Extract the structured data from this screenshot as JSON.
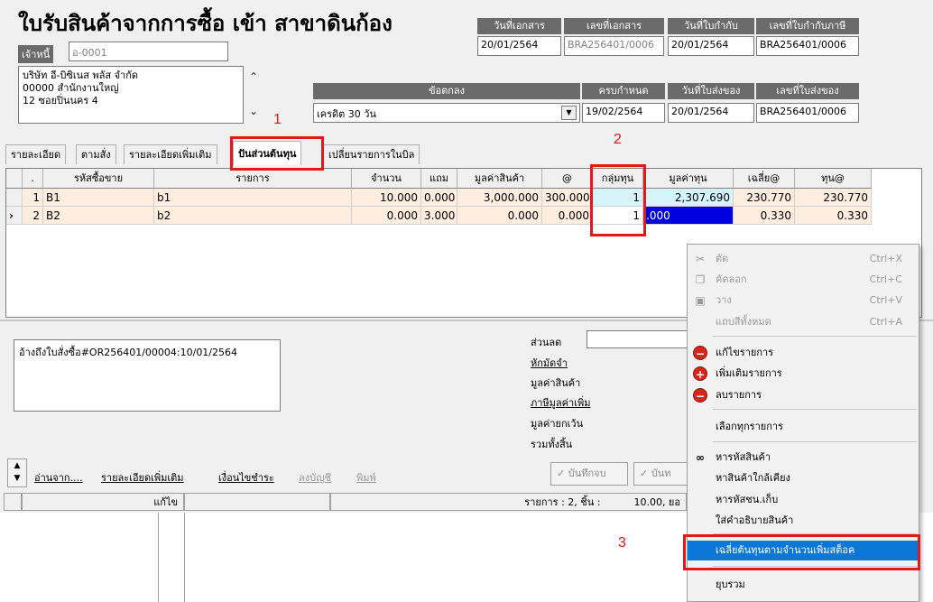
{
  "window": {
    "title": "ใบรับสินค้าจากการซื้อ เข้า สาขาดินก้อง"
  },
  "creditor": {
    "label": "เจ้าหนี้",
    "code": "อ-0001"
  },
  "supplier_address": [
    "บริษัท อี-บิซิเนส พลัส จำกัด",
    "00000 สำนักงานใหญ่",
    "12 ซอยปิ่นนคร 4"
  ],
  "doc_header": {
    "date_label": "วันที่เอกสาร",
    "date_value": "20/01/2564",
    "number_label": "เลขที่เอกสาร",
    "number_value": "BRA256401/0006",
    "tax_date_label": "วันที่ใบกำกับ",
    "tax_date_value": "20/01/2564",
    "tax_no_label": "เลขที่ใบกำกับภาษี",
    "tax_no_value": "BRA256401/0006"
  },
  "terms": {
    "terms_label": "ข้อตกลง",
    "terms_value": "เครดิต 30 วัน",
    "due_label": "ครบกำหนด",
    "due_value": "19/02/2564",
    "delivery_date_label": "วันที่ใบส่งของ",
    "delivery_date_value": "20/01/2564",
    "delivery_no_label": "เลขที่ใบส่งของ",
    "delivery_no_value": "BRA256401/0006"
  },
  "tabs": [
    {
      "label": "รายละเอียด"
    },
    {
      "label": "ตามสั่ง"
    },
    {
      "label": "รายละเอียดเพิ่มเติม"
    },
    {
      "label": "ปันส่วนต้นทุน",
      "active": true
    },
    {
      "label": "เปลี่ยนรายการในบิล"
    }
  ],
  "grid": {
    "columns": [
      ".",
      "รหัสซื้อขาย",
      "รายการ",
      "จำนวน",
      "แถม",
      "มูลค่าสินค้า",
      "@",
      "กลุ่มทุน",
      "มูลค่าทุน",
      "เฉลี่ย@",
      "ทุน@"
    ],
    "rows": [
      {
        "indicator": "",
        "no": "1",
        "code": "B1",
        "name": "b1",
        "qty": "10.000",
        "free": "0.000",
        "value": "3,000.000",
        "unit": "300.000",
        "group": "1",
        "cost_value": "2,307.690",
        "avg": "230.770",
        "cost": "230.770"
      },
      {
        "indicator": "›",
        "no": "2",
        "code": "B2",
        "name": "b2",
        "qty": "0.000",
        "free": "3.000",
        "value": "0.000",
        "unit": "0.000",
        "group": "1",
        "cost_value": ".000",
        "avg": "0.330",
        "cost": "0.330"
      }
    ]
  },
  "memo": "อ้างถึงใบสั่งซื้อ#OR256401/00004:10/01/2564",
  "summary": {
    "discount": "ส่วนลด",
    "deposit": "หักมัดจำ",
    "goods_value": "มูลค่าสินค้า",
    "vat": "ภาษีมูลค่าเพิ่ม",
    "exempt": "มูลค่ายกเว้น",
    "total": "รวมทั้งสิ้น"
  },
  "actions": {
    "read_from": "อ่านจาก....",
    "more_details": "รายละเอียดเพิ่มเติม",
    "payment_terms": "เงื่อนไขชำระ",
    "post": "ลงบัญชี",
    "print": "พิมพ์",
    "save": "บันทึกจบ",
    "save2": "บันท"
  },
  "status": {
    "mode": "แก้ไข",
    "items": "รายการ : 2, ชิ้น :",
    "qty": "10.00, ยอ"
  },
  "context_menu": {
    "items": [
      {
        "label": "ตัด",
        "shortcut": "Ctrl+X",
        "enabled": false,
        "icon": "scissors-icon"
      },
      {
        "label": "คัดลอก",
        "shortcut": "Ctrl+C",
        "enabled": false,
        "icon": "copy-icon"
      },
      {
        "label": "วาง",
        "shortcut": "Ctrl+V",
        "enabled": false,
        "icon": "paste-icon"
      },
      {
        "label": "แถบสีทั้งหมด",
        "shortcut": "Ctrl+A",
        "enabled": false,
        "icon": ""
      },
      {
        "label": "แก้ไขรายการ",
        "shortcut": "",
        "enabled": true,
        "icon": "edit-row-icon"
      },
      {
        "label": "เพิ่มเติมรายการ",
        "shortcut": "",
        "enabled": true,
        "icon": "add-row-icon"
      },
      {
        "label": "ลบรายการ",
        "shortcut": "",
        "enabled": true,
        "icon": "delete-row-icon"
      },
      {
        "label": "เลือกทุกรายการ",
        "shortcut": "",
        "enabled": true,
        "icon": ""
      },
      {
        "label": "หารหัสสินค้า",
        "shortcut": "",
        "enabled": true,
        "icon": "binoculars-icon"
      },
      {
        "label": "หาสินค้าใกล้เคียง",
        "shortcut": "",
        "enabled": true,
        "icon": ""
      },
      {
        "label": "หารหัสชน.เก็บ",
        "shortcut": "",
        "enabled": true,
        "icon": ""
      },
      {
        "label": "ใส่คำอธิบายสินค้า",
        "shortcut": "",
        "enabled": true,
        "icon": ""
      },
      {
        "label": "เฉลี่ยต้นทุนตามจำนวนเพิ่มสต็อค",
        "shortcut": "",
        "enabled": true,
        "icon": ""
      },
      {
        "label": "ยุบรวม",
        "shortcut": "",
        "enabled": true,
        "icon": ""
      }
    ]
  },
  "annotations": [
    "1",
    "2",
    "3"
  ]
}
